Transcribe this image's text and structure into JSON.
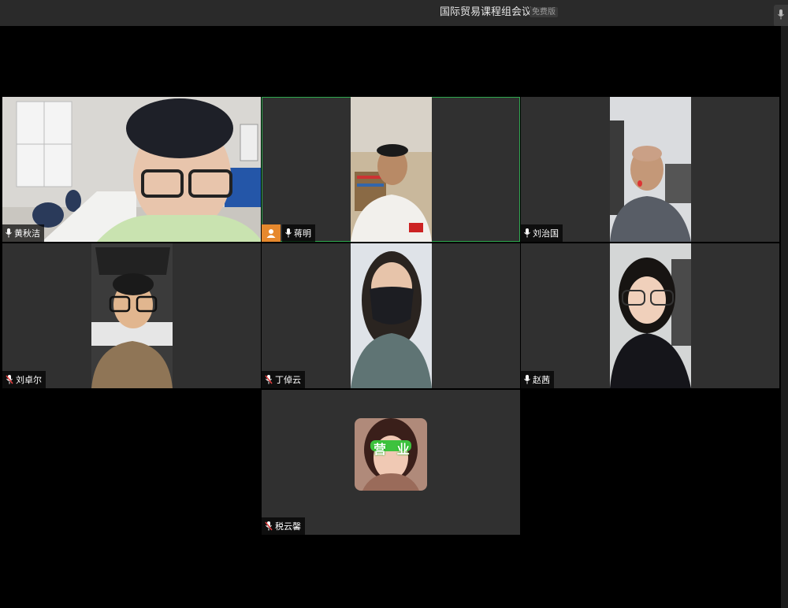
{
  "window": {
    "title": "国际贸易课程组会议",
    "edition_badge": "免费版"
  },
  "participants": [
    {
      "name": "黄秋洁",
      "mic": "on",
      "video": "on"
    },
    {
      "name": "蒋明",
      "mic": "on",
      "video": "on",
      "host": true,
      "speaking": true
    },
    {
      "name": "刘治国",
      "mic": "on",
      "video": "on"
    },
    {
      "name": "刘卓尔",
      "mic": "muted",
      "video": "on"
    },
    {
      "name": "丁倬云",
      "mic": "muted",
      "video": "on"
    },
    {
      "name": "赵茜",
      "mic": "on",
      "video": "on"
    },
    {
      "name": "税云馨",
      "mic": "muted",
      "video": "off",
      "avatar_text": "营 业"
    }
  ],
  "colors": {
    "active_border": "#2ea84f",
    "host_badge": "#e6882d",
    "muted_icon": "#e04040",
    "tile_bg": "#303030"
  },
  "icons": [
    "mic-icon",
    "mic-muted-icon",
    "host-icon"
  ]
}
